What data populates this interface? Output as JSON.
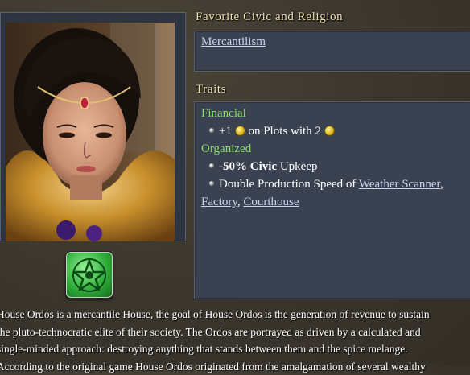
{
  "headings": {
    "civic_religion": "Favorite Civic and Religion",
    "traits": "Traits"
  },
  "civic": {
    "name": "Mercantilism"
  },
  "traits": [
    {
      "name": "Financial",
      "effects": [
        {
          "prefix": "+1",
          "middle": " on Plots with 2",
          "icon": "gold-coin-icon"
        }
      ]
    },
    {
      "name": "Organized",
      "effects": [
        {
          "bold": "-50% Civic",
          "rest": " Upkeep"
        },
        {
          "prefix": "Double Production Speed of ",
          "links": [
            "Weather Scanner",
            "Factory",
            "Courthouse"
          ]
        }
      ]
    }
  ],
  "religion": {
    "icon": "religion-star-icon"
  },
  "description_lines": [
    "House Ordos is a mercantile House, the goal of House Ordos is the generation of revenue to sustain",
    "the pluto-technocratic elite of their society. The Ordos are portrayed as driven by a calculated and",
    "single-minded approach: destroying anything that stands between them and the spice melange.",
    "According to the original game House Ordos originated from the amalgamation of several wealthy"
  ],
  "colors": {
    "background": "#3f3a30",
    "panel": "#3a4150",
    "heading": "#f3e3b0",
    "trait_name": "#88e066",
    "link": "#c7d4ee"
  }
}
